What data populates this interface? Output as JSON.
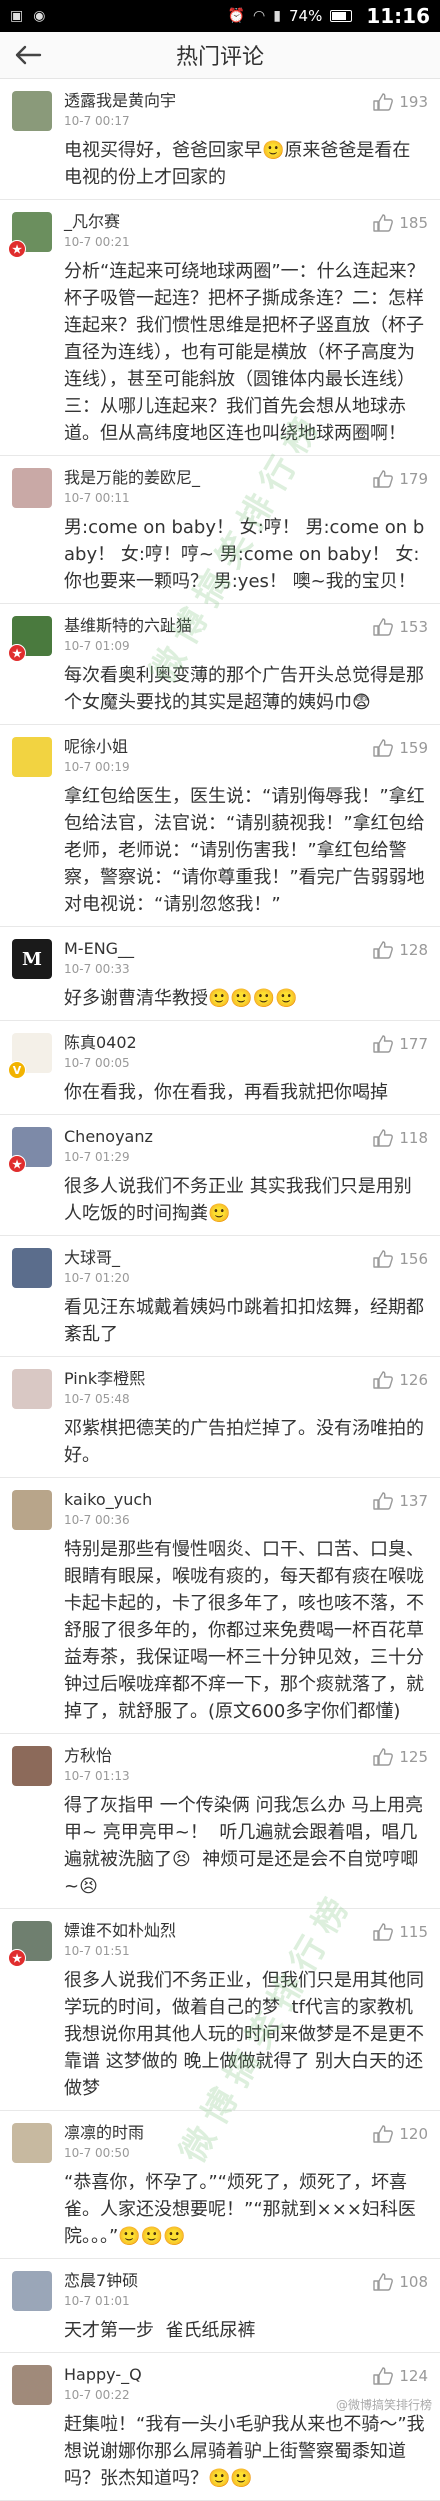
{
  "status_bar": {
    "battery": "74%",
    "time": "11:16",
    "icons": [
      "photo-icon",
      "wechat-icon",
      "alarm-icon",
      "wifi-icon",
      "signal-icon",
      "battery-icon"
    ]
  },
  "nav": {
    "title": "热门评论",
    "back_icon": "back-arrow-icon"
  },
  "comments": [
    {
      "name": "透露我是黄向宇",
      "time": "10-7 00:17",
      "likes": "193",
      "avatar_color": "#8a9a7a",
      "text": "电视买得好，爸爸回家早🙂原来爸爸是看在电视的份上才回家的"
    },
    {
      "name": "_凡尔赛",
      "time": "10-7 00:21",
      "likes": "185",
      "avatar_color": "#6b8f5e",
      "badge": "red",
      "text": "分析“连起来可绕地球两圈”一：什么连起来？杯子吸管一起连？把杯子撕成条连？二：怎样连起来？我们惯性思维是把杯子竖直放（杯子直径为连线），也有可能是横放（杯子高度为连线），甚至可能斜放（圆锥体内最长连线）三：从哪儿连起来？我们首先会想从地球赤道。但从高纬度地区连也叫绕地球两圈啊！"
    },
    {
      "name": "我是万能的姜欧尼_",
      "time": "10-7 00:11",
      "likes": "179",
      "avatar_color": "#c9a9a6",
      "text": "男:come on baby！ 女:哼！ 男:come on baby！ 女:哼！哼~ 男:come on baby！ 女:你也要来一颗吗？ 男:yes！ 噢~我的宝贝！"
    },
    {
      "name": "基维斯特的六趾猫",
      "time": "10-7 01:09",
      "likes": "153",
      "avatar_color": "#4a7a3e",
      "badge": "red",
      "text": "每次看奥利奥变薄的那个广告开头总觉得是那个女魔头要找的其实是超薄的姨妈巾😨"
    },
    {
      "name": "呢徐小姐",
      "time": "10-7 00:19",
      "likes": "159",
      "avatar_color": "#f2d341",
      "text": "拿红包给医生，医生说：“请别侮辱我！”拿红包给法官，法官说：“请别藐视我！”拿红包给老师，老师说：“请别伤害我！”拿红包给警察，警察说：“请你尊重我！”看完广告弱弱地对电视说：“请别忽悠我！”"
    },
    {
      "name": "M-ENG__",
      "time": "10-7 00:33",
      "likes": "128",
      "avatar_color": "#1a1a1a",
      "avatar_letter": "M",
      "text": "好多谢曹清华教授🙂🙂🙂🙂"
    },
    {
      "name": "陈真0402",
      "time": "10-7 00:05",
      "likes": "177",
      "avatar_color": "#f4f0e8",
      "badge": "v",
      "text": "你在看我，你在看我，再看我就把你喝掉"
    },
    {
      "name": "Chenoyanz",
      "time": "10-7 01:29",
      "likes": "118",
      "avatar_color": "#7d8aa8",
      "badge": "red",
      "text": "很多人说我们不务正业 其实我我们只是用别人吃饭的时间掏粪🙂"
    },
    {
      "name": "大球哥_",
      "time": "10-7 01:20",
      "likes": "156",
      "avatar_color": "#5b6d8c",
      "text": "看见汪东城戴着姨妈巾跳着扣扣炫舞，经期都紊乱了"
    },
    {
      "name": "Pink李橙熙",
      "time": "10-7 05:48",
      "likes": "126",
      "avatar_color": "#d9c8c4",
      "text": "邓紫棋把德芙的广告拍烂掉了。没有汤唯拍的好。"
    },
    {
      "name": "kaiko_yuch",
      "time": "10-7 00:36",
      "likes": "137",
      "avatar_color": "#b8a58a",
      "text": "特别是那些有慢性咽炎、口干、口苦、口臭、眼睛有眼屎，喉咙有痰的，每天都有痰在喉咙卡起卡起的，卡了很多年了，咳也咳不落，不舒服了很多年的，你都过来免费喝一杯百花草益寿茶，我保证喝一杯三十分钟见效，三十分钟过后喉咙痒都不痒一下，那个痰就落了，就掉了，就舒服了。(原文600多字你们都懂)"
    },
    {
      "name": "方秋怡",
      "time": "10-7 01:13",
      "likes": "125",
      "avatar_color": "#8c6a5a",
      "text": "得了灰指甲 一个传染俩 问我怎么办 马上用亮甲~ 亮甲亮甲~！  听几遍就会跟着唱，唱几遍就被洗脑了😣  神烦可是还是会不自觉哼唧~😣"
    },
    {
      "name": "嫖谁不如朴灿烈",
      "time": "10-7 01:51",
      "likes": "115",
      "avatar_color": "#6f7f6f",
      "badge": "red",
      "text": "很多人说我们不务正业，但我们只是用其他同学玩的时间，做着自己的梦  tf代言的家教机  我想说你用其他人玩的时间来做梦是不是更不靠谱 这梦做的 晚上做做就得了 别大白天的还做梦"
    },
    {
      "name": "凛凛的时雨",
      "time": "10-7 00:50",
      "likes": "120",
      "avatar_color": "#c7b9a0",
      "text": "“恭喜你，怀孕了。”“烦死了，烦死了，坏喜雀。人家还没想要呢！”“那就到×××妇科医院。。。”🙂🙂🙂"
    },
    {
      "name": "恋晨7钟硕",
      "time": "10-7 01:01",
      "likes": "108",
      "avatar_color": "#9aa6b8",
      "text": "天才第一步  雀氏纸尿裤"
    },
    {
      "name": "Happy-_Q",
      "time": "10-7 00:22",
      "likes": "124",
      "avatar_color": "#a08a7a",
      "text": "赶集啦！“我有一头小毛驴我从来也不骑～”我想说谢娜你那么屌骑着驴上街警察蜀黍知道吗？张杰知道吗？🙂🙂"
    }
  ],
  "watermark": "微博搞笑排行榜",
  "footer": "@微博搞笑排行榜"
}
